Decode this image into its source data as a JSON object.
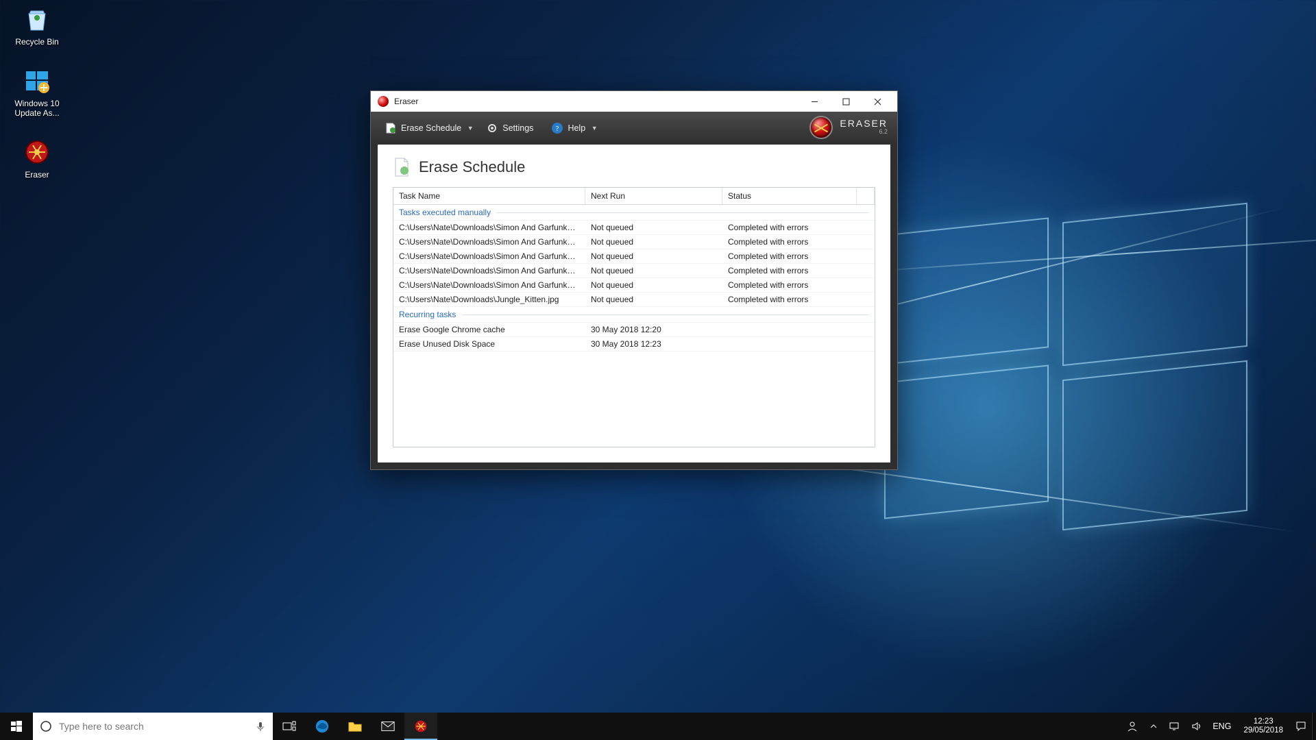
{
  "desktop": {
    "icons": [
      {
        "name": "recycle-bin",
        "label": "Recycle Bin"
      },
      {
        "name": "windows-update-assistant",
        "label": "Windows 10\nUpdate As..."
      },
      {
        "name": "eraser-shortcut",
        "label": "Eraser"
      }
    ]
  },
  "window": {
    "title": "Eraser",
    "brand_name": "ERASER",
    "brand_version": "6.2",
    "toolbar": {
      "erase_schedule": "Erase Schedule",
      "settings": "Settings",
      "help": "Help"
    },
    "section_title": "Erase Schedule",
    "columns": {
      "c1": "Task Name",
      "c2": "Next Run",
      "c3": "Status"
    },
    "group_manual": "Tasks executed manually",
    "group_recurring": "Recurring tasks",
    "manual_tasks": [
      {
        "name": "C:\\Users\\Nate\\Downloads\\Simon And Garfunkel ...",
        "next": "Not queued",
        "status": "Completed with errors"
      },
      {
        "name": "C:\\Users\\Nate\\Downloads\\Simon And Garfunkel ...",
        "next": "Not queued",
        "status": "Completed with errors"
      },
      {
        "name": "C:\\Users\\Nate\\Downloads\\Simon And Garfunkel ...",
        "next": "Not queued",
        "status": "Completed with errors"
      },
      {
        "name": "C:\\Users\\Nate\\Downloads\\Simon And Garfunkel ...",
        "next": "Not queued",
        "status": "Completed with errors"
      },
      {
        "name": "C:\\Users\\Nate\\Downloads\\Simon And Garfunkel ...",
        "next": "Not queued",
        "status": "Completed with errors"
      },
      {
        "name": "C:\\Users\\Nate\\Downloads\\Jungle_Kitten.jpg",
        "next": "Not queued",
        "status": "Completed with errors"
      }
    ],
    "recurring_tasks": [
      {
        "name": "Erase Google Chrome cache",
        "next": "30 May 2018 12:20",
        "status": ""
      },
      {
        "name": "Erase Unused Disk Space",
        "next": "30 May 2018 12:23",
        "status": ""
      }
    ]
  },
  "taskbar": {
    "search_placeholder": "Type here to search",
    "lang": "ENG",
    "time": "12:23",
    "date": "29/05/2018"
  }
}
